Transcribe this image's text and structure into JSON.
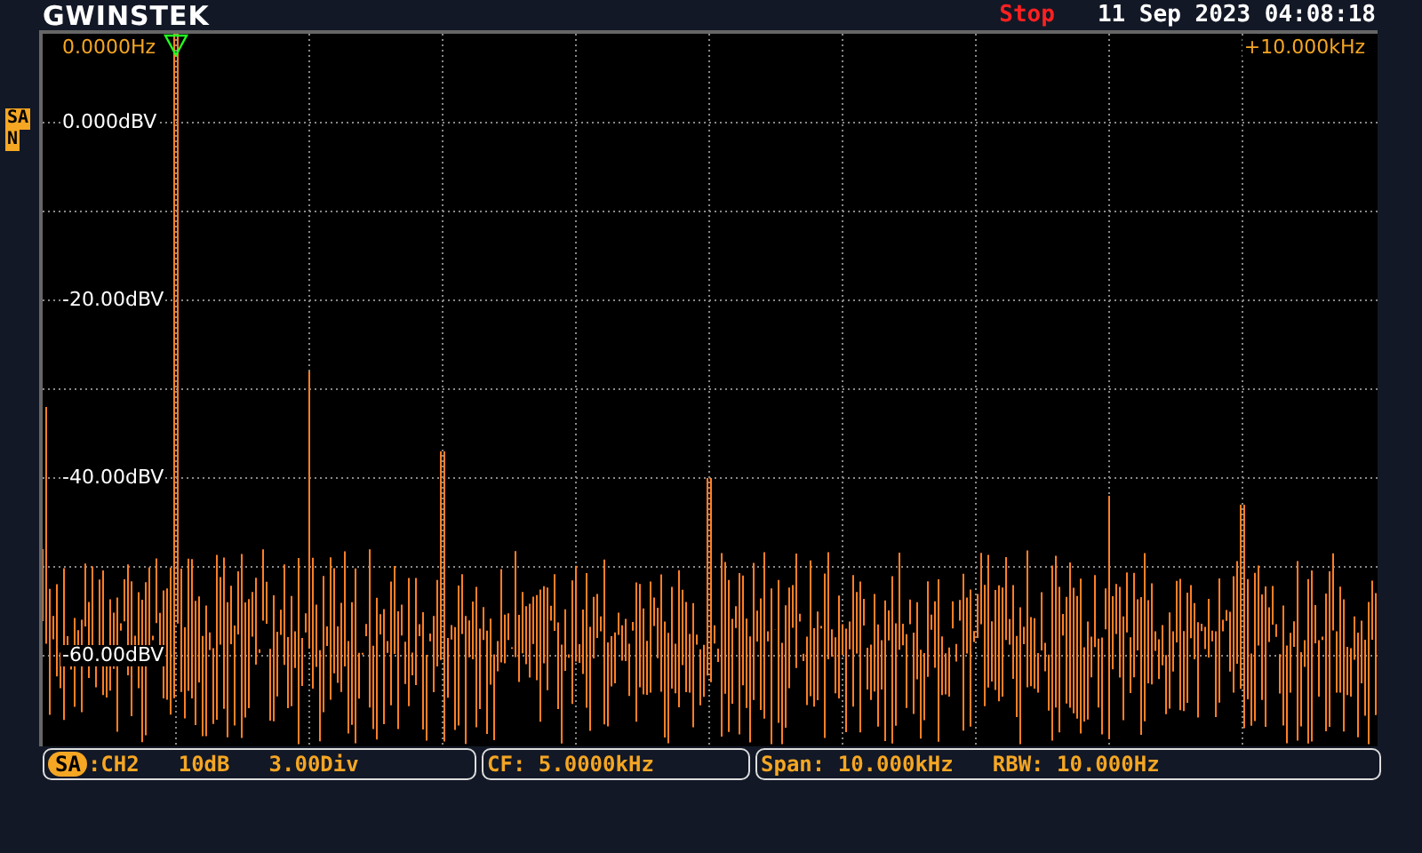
{
  "header": {
    "logo": "GWINSTEK",
    "status": "Stop",
    "datetime": "11 Sep 2023 04:08:18"
  },
  "screen": {
    "start_frequency": "0.0000Hz",
    "end_frequency": "+10.000kHz",
    "channel_badges": [
      "SA",
      "N"
    ],
    "y_labels": [
      "0.000dBV",
      "-20.00dBV",
      "-40.00dBV",
      "-60.00dBV"
    ]
  },
  "info_bar": {
    "mode_badge": "SA",
    "segments": [
      [
        ":CH2",
        "10dB",
        "3.00Div"
      ],
      [
        "CF: 5.0000kHz"
      ],
      [
        "Span: 10.000kHz",
        "RBW: 10.000Hz"
      ]
    ]
  }
}
